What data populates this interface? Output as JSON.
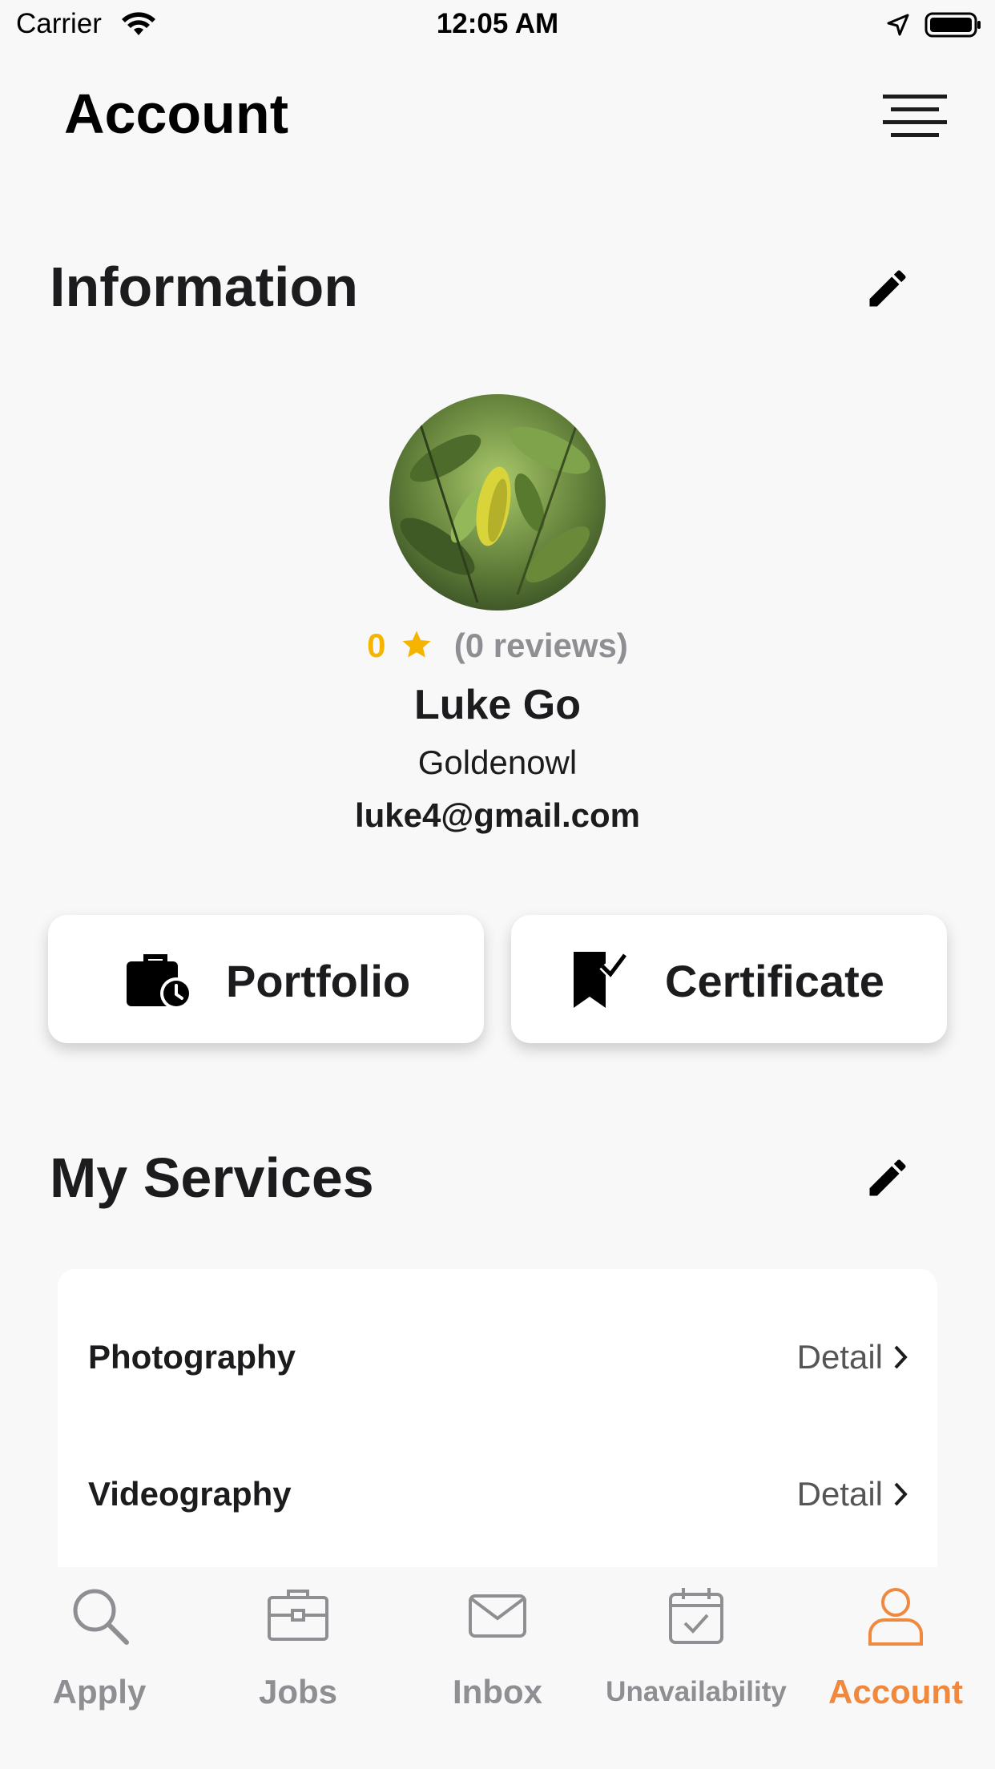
{
  "status_bar": {
    "carrier": "Carrier",
    "time": "12:05 AM"
  },
  "header": {
    "title": "Account"
  },
  "information": {
    "title": "Information",
    "rating": "0",
    "reviews": "(0 reviews)",
    "name": "Luke Go",
    "company": "Goldenowl",
    "email": "luke4@gmail.com"
  },
  "actions": {
    "portfolio_label": "Portfolio",
    "certificate_label": "Certificate"
  },
  "services": {
    "title": "My Services",
    "items": [
      {
        "name": "Photography",
        "detail": "Detail"
      },
      {
        "name": "Videography",
        "detail": "Detail"
      }
    ]
  },
  "tab_bar": {
    "active": "Account",
    "items": [
      {
        "label": "Apply",
        "icon": "search-icon"
      },
      {
        "label": "Jobs",
        "icon": "briefcase-icon"
      },
      {
        "label": "Inbox",
        "icon": "mail-icon"
      },
      {
        "label": "Unavailability",
        "icon": "calendar-check-icon"
      },
      {
        "label": "Account",
        "icon": "person-icon"
      }
    ]
  },
  "colors": {
    "accent": "#f0883e",
    "star": "#f4b400",
    "inactive": "#8e8e93",
    "background": "#f8f8f8"
  }
}
